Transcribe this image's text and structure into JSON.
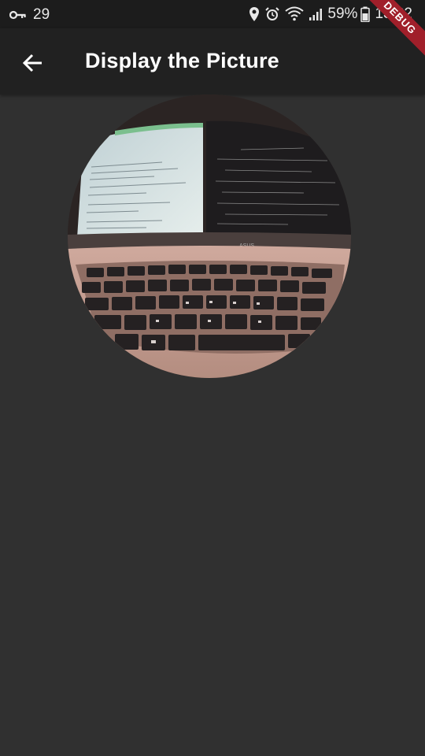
{
  "status_bar": {
    "left_number": "29",
    "battery_percent": "59%",
    "time": "13:32"
  },
  "app_bar": {
    "title": "Display the Picture",
    "back_icon": "arrow-back-icon"
  },
  "debug_banner": "DEBUG",
  "picture": {
    "laptop_brand": "ASUS"
  },
  "colors": {
    "background": "#303030",
    "app_bar": "#212121",
    "status_bar": "#1c1c1c",
    "debug_banner": "#a01f2a"
  }
}
